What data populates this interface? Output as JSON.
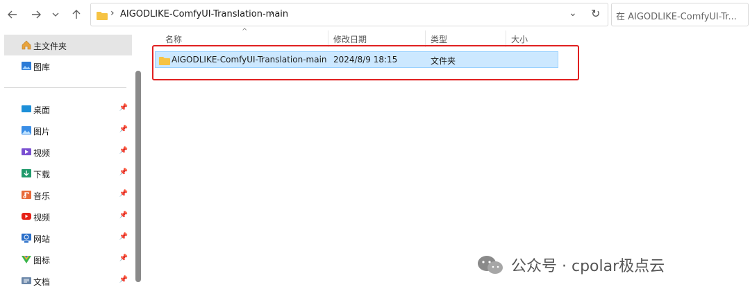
{
  "address_bar": {
    "path_crumb": "AIGODLIKE-ComfyUI-Translation-main",
    "search_placeholder": "在 AIGODLIKE-ComfyUI-Tr..."
  },
  "sidebar": {
    "items": [
      {
        "label": "主文件夹",
        "icon": "home-icon",
        "selected": true
      },
      {
        "label": "图库",
        "icon": "gallery-icon"
      },
      {
        "label": "桌面",
        "icon": "desktop-icon",
        "pinned": true
      },
      {
        "label": "图片",
        "icon": "pictures-icon",
        "pinned": true
      },
      {
        "label": "视频",
        "icon": "videos-icon",
        "pinned": true
      },
      {
        "label": "下载",
        "icon": "downloads-icon",
        "pinned": true
      },
      {
        "label": "音乐",
        "icon": "music-icon",
        "pinned": true
      },
      {
        "label": "视频",
        "icon": "youtube-icon",
        "pinned": true
      },
      {
        "label": "网站",
        "icon": "website-icon",
        "pinned": true
      },
      {
        "label": "图标",
        "icon": "icons-icon",
        "pinned": true
      },
      {
        "label": "文档",
        "icon": "documents-icon",
        "pinned": true
      }
    ]
  },
  "columns": {
    "name": "名称",
    "modified": "修改日期",
    "type": "类型",
    "size": "大小"
  },
  "files": [
    {
      "name": "AIGODLIKE-ComfyUI-Translation-main",
      "modified": "2024/8/9 18:15",
      "type": "文件夹",
      "size": ""
    }
  ],
  "watermark": {
    "text": "公众号 · cpolar极点云"
  },
  "colors": {
    "selection_fill": "#cce8ff",
    "highlight_border": "#e02020",
    "folder_yellow": "#f6c343"
  }
}
